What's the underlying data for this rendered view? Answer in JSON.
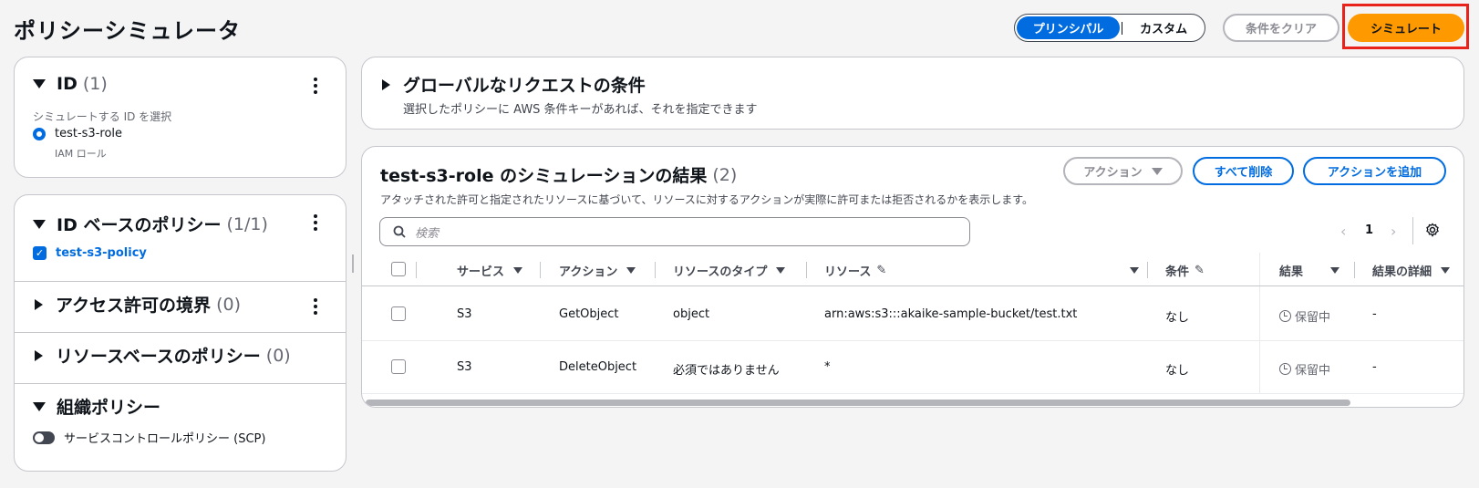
{
  "page_title": "ポリシーシミュレータ",
  "header": {
    "segmented": [
      "プリンシパル",
      "カスタム"
    ],
    "clear_conditions": "条件をクリア",
    "simulate": "シミュレート"
  },
  "identity_panel": {
    "title": "ID",
    "count": "(1)",
    "select_label": "シミュレートする ID を選択",
    "selected_name": "test-s3-role",
    "selected_type": "IAM ロール"
  },
  "identity_policies": {
    "title": "ID ベースのポリシー",
    "count": "(1/1)",
    "policy_name": "test-s3-policy"
  },
  "permission_boundary": {
    "title": "アクセス許可の境界",
    "count": "(0)"
  },
  "resource_policies": {
    "title": "リソースベースのポリシー",
    "count": "(0)"
  },
  "org_policies": {
    "title": "組織ポリシー",
    "scp_label": "サービスコントロールポリシー (SCP)"
  },
  "global_conditions": {
    "title": "グローバルなリクエストの条件",
    "description": "選択したポリシーに AWS 条件キーがあれば、それを指定できます"
  },
  "results": {
    "title": "test-s3-role のシミュレーションの結果",
    "count": "(2)",
    "description": "アタッチされた許可と指定されたリソースに基づいて、リソースに対するアクションが実際に許可または拒否されるかを表示します。",
    "actions_dropdown": "アクション",
    "delete_all": "すべて削除",
    "add_action": "アクションを追加",
    "search_placeholder": "検索",
    "page": "1",
    "columns": [
      "サービス",
      "アクション",
      "リソースのタイプ",
      "リソース",
      "条件",
      "結果",
      "結果の詳細"
    ],
    "rows": [
      {
        "service": "S3",
        "action": "GetObject",
        "resource_type": "object",
        "resource": "arn:aws:s3:::akaike-sample-bucket/test.txt",
        "condition": "なし",
        "result": "保留中",
        "detail": "-"
      },
      {
        "service": "S3",
        "action": "DeleteObject",
        "resource_type": "必須ではありません",
        "resource": "*",
        "condition": "なし",
        "result": "保留中",
        "detail": "-"
      }
    ]
  },
  "colors": {
    "accent": "#006ce0",
    "primary": "#ff9900",
    "highlight": "#e8231c"
  }
}
